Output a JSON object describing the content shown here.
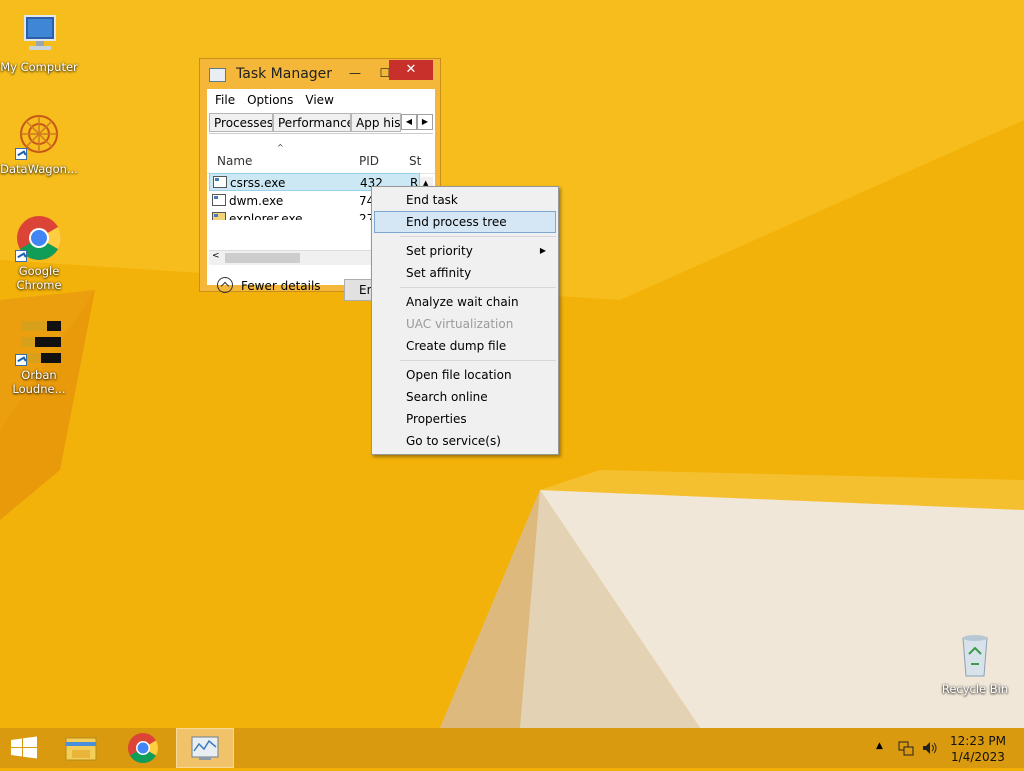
{
  "desktop": {
    "icons": [
      {
        "label": "My Computer"
      },
      {
        "label": "DataWagon..."
      },
      {
        "label": "Google Chrome"
      },
      {
        "label": "Orban Loudne..."
      },
      {
        "label": "Recycle Bin"
      }
    ]
  },
  "task_manager": {
    "title": "Task Manager",
    "menu": [
      "File",
      "Options",
      "View"
    ],
    "tabs": [
      "Processes",
      "Performance",
      "App his"
    ],
    "columns": {
      "name": "Name",
      "pid": "PID",
      "status": "St"
    },
    "rows": [
      {
        "name": "csrss.exe",
        "pid": "432",
        "status": "R"
      },
      {
        "name": "dwm.exe",
        "pid": "74",
        "status": ""
      },
      {
        "name": "explorer.exe",
        "pid": "27",
        "status": ""
      }
    ],
    "fewer_details": "Fewer details",
    "end_task_button": "En"
  },
  "context_menu": {
    "items": [
      {
        "label": "End task",
        "state": "normal"
      },
      {
        "label": "End process tree",
        "state": "highlighted"
      },
      {
        "label": "Set priority",
        "state": "submenu"
      },
      {
        "label": "Set affinity",
        "state": "normal"
      },
      {
        "label": "Analyze wait chain",
        "state": "normal"
      },
      {
        "label": "UAC virtualization",
        "state": "disabled"
      },
      {
        "label": "Create dump file",
        "state": "normal"
      },
      {
        "label": "Open file location",
        "state": "normal"
      },
      {
        "label": "Search online",
        "state": "normal"
      },
      {
        "label": "Properties",
        "state": "normal"
      },
      {
        "label": "Go to service(s)",
        "state": "normal"
      }
    ]
  },
  "taskbar": {
    "clock_time": "12:23 PM",
    "clock_date": "1/4/2023",
    "pinned": [
      "windows-start-icon",
      "file-explorer-icon",
      "chrome-icon",
      "task-manager-icon"
    ]
  },
  "colors": {
    "wallpaper": "#f2b106",
    "taskbar": "#d99a10",
    "menu_highlight": "#d5e6f5"
  }
}
